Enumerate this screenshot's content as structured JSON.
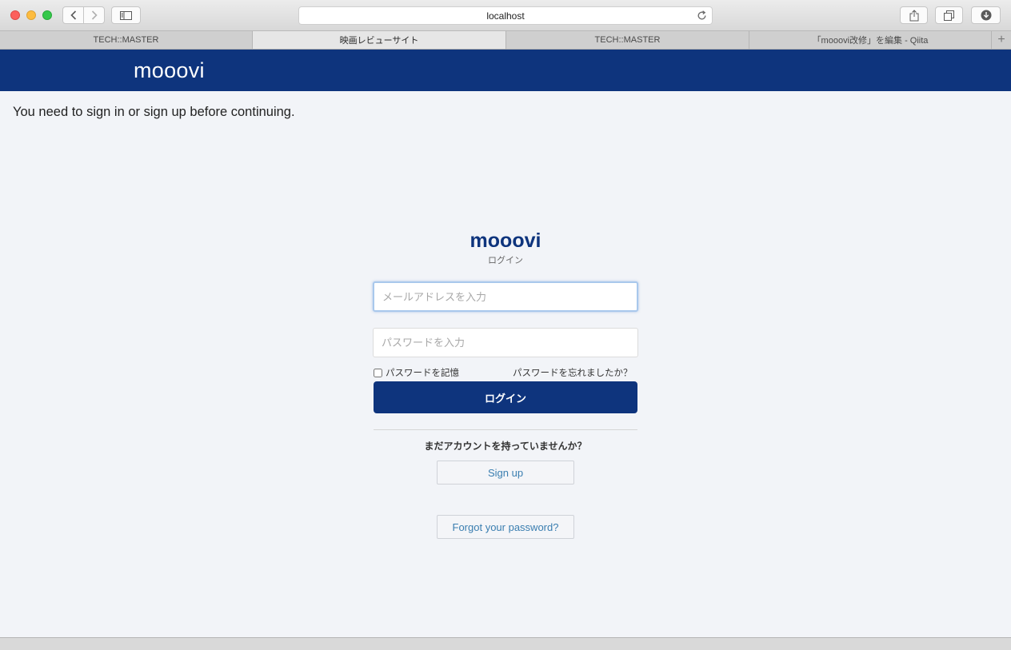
{
  "browser": {
    "url": "localhost",
    "tabs": [
      {
        "label": "TECH::MASTER",
        "active": false
      },
      {
        "label": "映画レビューサイト",
        "active": true
      },
      {
        "label": "TECH::MASTER",
        "active": false
      },
      {
        "label": "「mooovi改修」を編集 - Qiita",
        "active": false
      }
    ],
    "new_tab_label": "+"
  },
  "site": {
    "logo": "mooovi"
  },
  "flash": {
    "message": "You need to sign in or sign up before continuing."
  },
  "login": {
    "logo": "mooovi",
    "subtitle": "ログイン",
    "email_placeholder": "メールアドレスを入力",
    "password_placeholder": "パスワードを入力",
    "remember_label": "パスワードを記憶",
    "forgot_inline": "パスワードを忘れましたか？",
    "submit_label": "ログイン",
    "no_account_text": "まだアカウントを持っていませんか？",
    "signup_label": "Sign up",
    "forgot_label": "Forgot your password?"
  },
  "colors": {
    "brand": "#0e347d",
    "link": "#3a7eb0",
    "background": "#f2f4f8"
  }
}
